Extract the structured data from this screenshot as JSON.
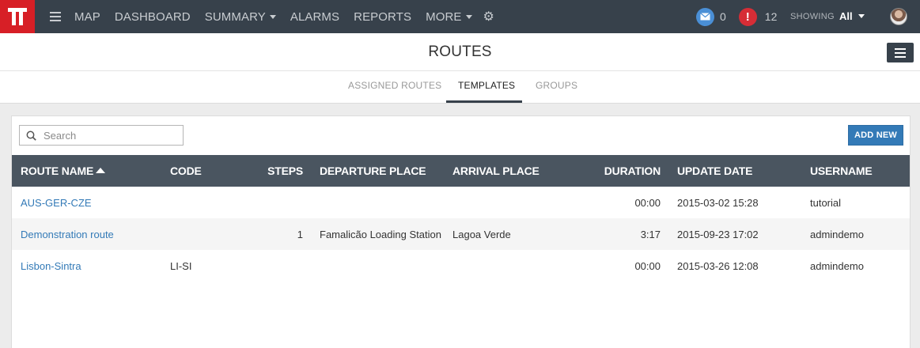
{
  "topbar": {
    "nav": [
      {
        "label": "MAP",
        "dropdown": false
      },
      {
        "label": "DASHBOARD",
        "dropdown": false
      },
      {
        "label": "SUMMARY",
        "dropdown": true
      },
      {
        "label": "ALARMS",
        "dropdown": false
      },
      {
        "label": "REPORTS",
        "dropdown": false
      },
      {
        "label": "MORE",
        "dropdown": true
      }
    ],
    "messages_count": "0",
    "alerts_icon": "!",
    "alerts_count": "12",
    "showing_label": "SHOWING",
    "showing_value": "All",
    "colors": {
      "bar": "#37414b",
      "logo": "#d71f26",
      "message_badge": "#4a8fd6",
      "alert_badge": "#d62d36"
    }
  },
  "header": {
    "title": "ROUTES"
  },
  "tabs": [
    {
      "label": "ASSIGNED ROUTES",
      "active": false
    },
    {
      "label": "TEMPLATES",
      "active": true
    },
    {
      "label": "GROUPS",
      "active": false
    }
  ],
  "toolbar": {
    "search_placeholder": "Search",
    "add_label": "ADD NEW",
    "add_color": "#337ab7"
  },
  "table": {
    "sorted_by": "ROUTE NAME",
    "sort_direction": "ascending",
    "columns": {
      "route_name": "ROUTE NAME",
      "code": "CODE",
      "steps": "STEPS",
      "departure": "DEPARTURE PLACE",
      "arrival": "ARRIVAL PLACE",
      "duration": "DURATION",
      "update_date": "UPDATE DATE",
      "username": "USERNAME"
    },
    "rows": [
      {
        "route_name": "AUS-GER-CZE",
        "code": "",
        "steps": "",
        "departure": "",
        "arrival": "",
        "duration": "00:00",
        "update_date": "2015-03-02 15:28",
        "username": "tutorial"
      },
      {
        "route_name": "Demonstration route",
        "code": "",
        "steps": "1",
        "departure": "Famalicão Loading Station",
        "arrival": "Lagoa Verde",
        "duration": "3:17",
        "update_date": "2015-09-23 17:02",
        "username": "admindemo"
      },
      {
        "route_name": "Lisbon-Sintra",
        "code": "LI-SI",
        "steps": "",
        "departure": "",
        "arrival": "",
        "duration": "00:00",
        "update_date": "2015-03-26 12:08",
        "username": "admindemo"
      }
    ]
  }
}
